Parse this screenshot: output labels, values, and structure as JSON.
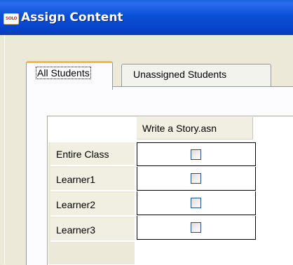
{
  "window": {
    "title": "Assign Content",
    "icon_text": "SOLO",
    "icon": "solo-app-icon"
  },
  "tabs": [
    {
      "label": "All Students",
      "selected": true
    },
    {
      "label": "Unassigned Students",
      "selected": false
    }
  ],
  "grid": {
    "column_header": "Write a Story.asn",
    "rows": [
      {
        "label": "Entire Class",
        "checked": false
      },
      {
        "label": "Learner1",
        "checked": false
      },
      {
        "label": "Learner2",
        "checked": false
      },
      {
        "label": "Learner3",
        "checked": false
      }
    ]
  },
  "colors": {
    "titlebar": "#0a4fd6",
    "active_tab_accent": "#f8b838"
  }
}
